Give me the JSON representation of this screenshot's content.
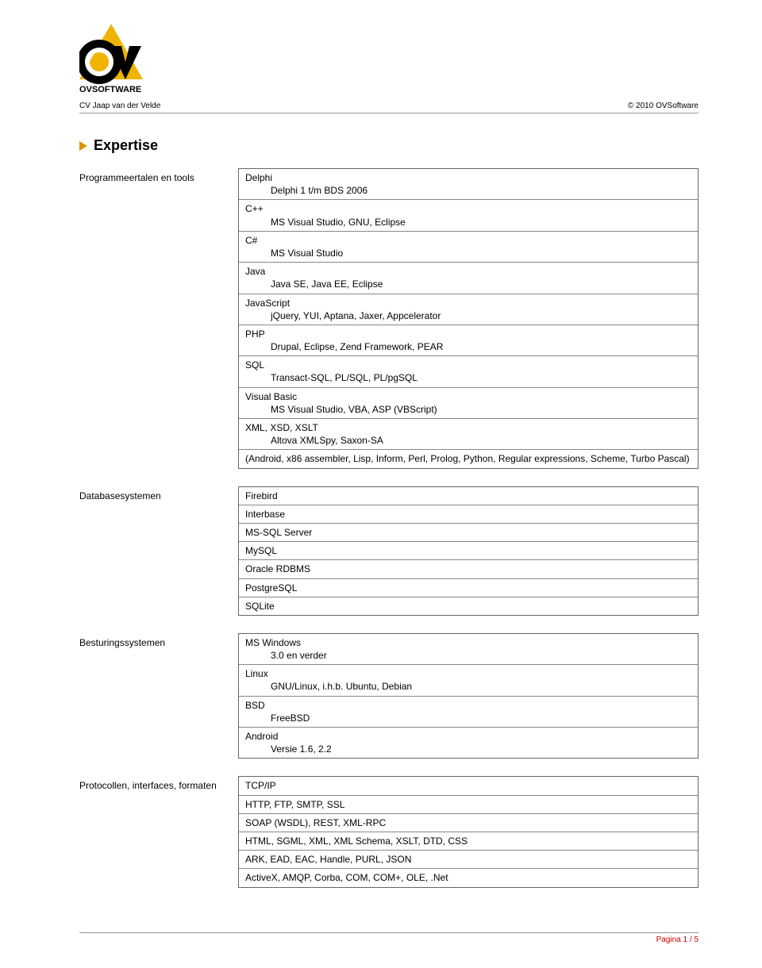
{
  "header": {
    "left": "CV Jaap van der Velde",
    "right": "© 2010 OVSoftware",
    "logo_text": "OVSOFTWARE"
  },
  "section_title": "Expertise",
  "blocks": [
    {
      "label": "Programmeertalen en tools",
      "rows": [
        {
          "text": "Delphi",
          "sub": "Delphi 1 t/m BDS 2006"
        },
        {
          "text": "C++",
          "sub": "MS Visual Studio, GNU, Eclipse"
        },
        {
          "text": "C#",
          "sub": "MS Visual Studio"
        },
        {
          "text": "Java",
          "sub": "Java SE, Java EE, Eclipse"
        },
        {
          "text": "JavaScript",
          "sub": "jQuery, YUI, Aptana, Jaxer, Appcelerator"
        },
        {
          "text": "PHP",
          "sub": "Drupal, Eclipse, Zend Framework, PEAR"
        },
        {
          "text": "SQL",
          "sub": "Transact-SQL, PL/SQL, PL/pgSQL"
        },
        {
          "text": "Visual Basic",
          "sub": "MS Visual Studio, VBA, ASP (VBScript)"
        },
        {
          "text": "XML, XSD, XSLT",
          "sub": "Altova XMLSpy, Saxon-SA"
        },
        {
          "text": "(Android, x86 assembler, Lisp, Inform, Perl, Prolog, Python, Regular expressions, Scheme, Turbo Pascal)"
        }
      ]
    },
    {
      "label": "Databasesystemen",
      "rows": [
        {
          "text": "Firebird"
        },
        {
          "text": "Interbase"
        },
        {
          "text": "MS-SQL Server"
        },
        {
          "text": "MySQL"
        },
        {
          "text": "Oracle RDBMS"
        },
        {
          "text": "PostgreSQL"
        },
        {
          "text": "SQLite"
        }
      ]
    },
    {
      "label": "Besturingssystemen",
      "rows": [
        {
          "text": "MS Windows",
          "sub": "3.0 en verder"
        },
        {
          "text": "Linux",
          "sub": "GNU/Linux, i.h.b. Ubuntu, Debian"
        },
        {
          "text": "BSD",
          "sub": "FreeBSD"
        },
        {
          "text": "Android",
          "sub": "Versie 1.6, 2.2"
        }
      ]
    },
    {
      "label": "Protocollen, interfaces, formaten",
      "rows": [
        {
          "text": "TCP/IP"
        },
        {
          "text": "HTTP, FTP, SMTP, SSL"
        },
        {
          "text": "SOAP (WSDL), REST, XML-RPC"
        },
        {
          "text": "HTML, SGML, XML, XML Schema, XSLT, DTD, CSS"
        },
        {
          "text": "ARK, EAD, EAC, Handle, PURL, JSON"
        },
        {
          "text": "ActiveX, AMQP, Corba, COM, COM+, OLE, .Net"
        }
      ]
    }
  ],
  "footer": "Pagina 1 / 5"
}
